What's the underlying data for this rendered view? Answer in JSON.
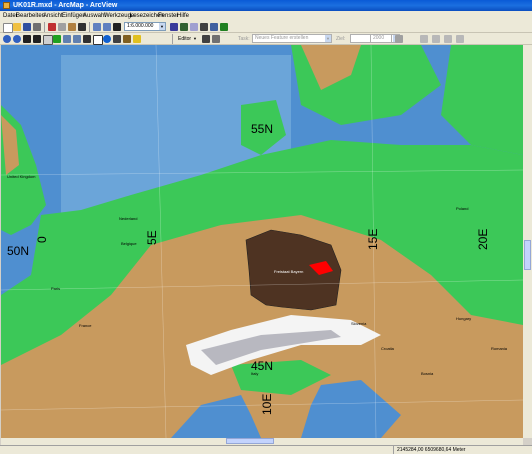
{
  "window": {
    "title": "UK01R.mxd - ArcMap - ArcView"
  },
  "menu": [
    "Datei",
    "Bearbeiten",
    "Ansicht",
    "Einfügen",
    "Auswahl",
    "Werkzeuge",
    "Lesezeichen",
    "Fenster",
    "Hilfe"
  ],
  "toolbar": {
    "scale": "1:6.000.000",
    "editor_label": "Editor",
    "task_placeholder": "Neues Feature erstellen",
    "target_label": "Ziel:",
    "zoom_value": "2000"
  },
  "map": {
    "grid_labels": {
      "lat_55": "55N",
      "lat_50": "50N",
      "lat_45": "45N",
      "lon_0": "0",
      "lon_5": "5E",
      "lon_10": "10E",
      "lon_15": "15E",
      "lon_20": "20E"
    },
    "highlighted_region": "Freistaat Bayern",
    "colors": {
      "sea": "#4f8fd0",
      "lowland": "#2cc84a",
      "highland": "#c89a5e",
      "mountain": "#ffffff",
      "region_fill": "#4e3322",
      "region_marker": "#ff0000"
    },
    "city_labels": [
      "United Kingdom",
      "Nederland",
      "Belgique",
      "Paris",
      "France",
      "Italy",
      "Hungary",
      "Poland",
      "Slovenia",
      "Croatia",
      "Bosnia",
      "Romania"
    ]
  },
  "status": {
    "coordinates": "2145284,00  6509680,64 Meter"
  }
}
